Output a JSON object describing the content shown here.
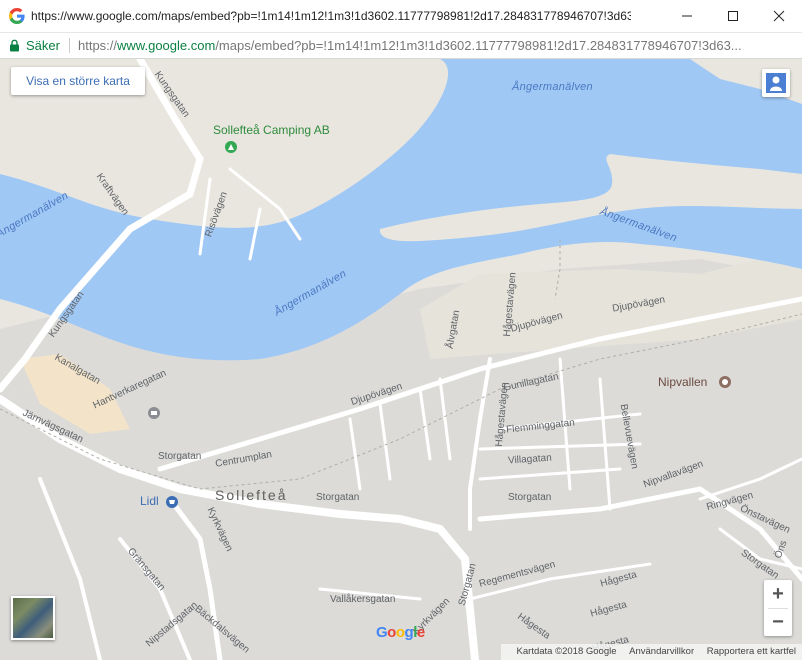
{
  "window": {
    "title": "https://www.google.com/maps/embed?pb=!1m14!1m12!1m3!1d3602.11777798981!2d17.284831778946707!3d63.16557...",
    "controls": [
      "minimize",
      "maximize",
      "close"
    ]
  },
  "address_bar": {
    "secure_label": "Säker",
    "url_scheme": "https://",
    "url_host": "www.google.com",
    "url_path": "/maps/embed?pb=!1m14!1m12!1m3!1d3602.11777798981!2d17.284831778946707!3d63..."
  },
  "map": {
    "view_larger_label": "Visa en större karta",
    "town_label": "Sollefteå",
    "river_labels": [
      "Ångermanälven",
      "Ångermanälven",
      "Ångermanälven",
      "Ångermanälven"
    ],
    "places": {
      "camping": "Sollefteå Camping AB",
      "lidl": "Lidl",
      "nipvallen": "Nipvallen"
    },
    "streets": [
      "Kungsgatan",
      "Kraftvägen",
      "Risövägen",
      "Kungsgatan",
      "Kanalgatan",
      "Hantverkaregatan",
      "Järnvägsgatan",
      "Storgatan",
      "Centrumplan",
      "Djupövägen",
      "Djupövägen",
      "Djupövägen",
      "Hågestavägen",
      "Ålvgatan",
      "Hågestavägen",
      "Gunillagatan",
      "Flemminggatan",
      "Villagatan",
      "Bellevuevägen",
      "Storgatan",
      "Storgatan",
      "Nipvallavägen",
      "Ringvägen",
      "Önstavägen",
      "Storgatan",
      "Kyrkvägen",
      "Gränsgatan",
      "Regementsvägen",
      "Vallåkersgatan",
      "Storgatan",
      "Kyrkvägen",
      "Nipstadsgatan",
      "Bäckdalsvägen",
      "Hågesta",
      "Hågesta",
      "Hågesta",
      "Hågesta",
      "Öns"
    ],
    "zoom_in": "+",
    "zoom_out": "−",
    "google_logo": [
      "G",
      "o",
      "o",
      "g",
      "l",
      "e"
    ],
    "footer": {
      "map_data": "Kartdata ©2018 Google",
      "terms": "Användarvillkor",
      "report": "Rapportera ett kartfel"
    }
  },
  "colors": {
    "water": "#a0c8f5",
    "land": "#e9e6df",
    "urban": "#dcdbd8",
    "road": "#ffffff",
    "sand": "#f3e6cc",
    "secure_green": "#0b8043",
    "link_blue": "#3c6eb4"
  },
  "icons": [
    "google-favicon-icon",
    "lock-icon",
    "pegman-icon",
    "camping-icon",
    "shopping-cart-icon",
    "stadium-icon",
    "bank-icon"
  ]
}
